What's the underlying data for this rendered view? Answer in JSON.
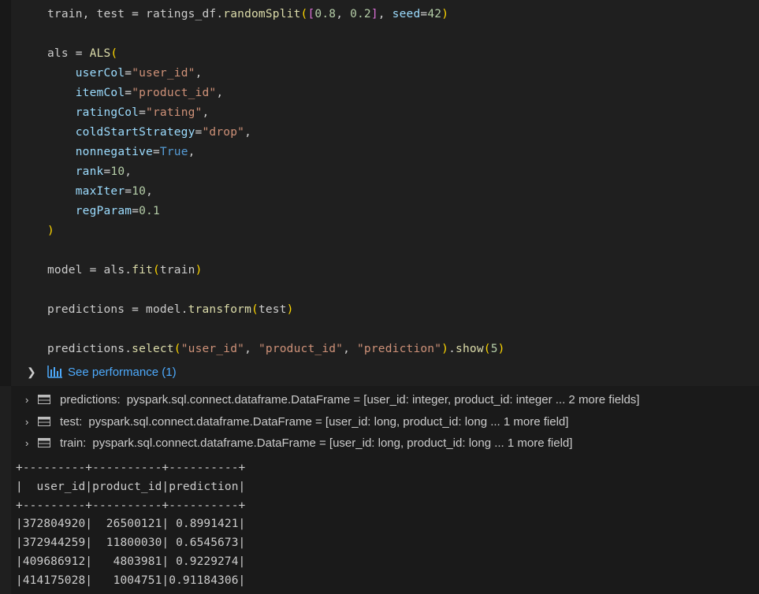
{
  "code": {
    "lines": [
      [
        {
          "t": "train, test ",
          "c": "ident"
        },
        {
          "t": "=",
          "c": "op"
        },
        {
          "t": " ratings_df.",
          "c": "ident"
        },
        {
          "t": "randomSplit",
          "c": "fn"
        },
        {
          "t": "(",
          "c": "br1"
        },
        {
          "t": "[",
          "c": "br2"
        },
        {
          "t": "0.8",
          "c": "num"
        },
        {
          "t": ", ",
          "c": "ident"
        },
        {
          "t": "0.2",
          "c": "num"
        },
        {
          "t": "]",
          "c": "br2"
        },
        {
          "t": ", ",
          "c": "ident"
        },
        {
          "t": "seed",
          "c": "param"
        },
        {
          "t": "=",
          "c": "op"
        },
        {
          "t": "42",
          "c": "num"
        },
        {
          "t": ")",
          "c": "br1"
        }
      ],
      [],
      [
        {
          "t": "als ",
          "c": "ident"
        },
        {
          "t": "=",
          "c": "op"
        },
        {
          "t": " ",
          "c": "ident"
        },
        {
          "t": "ALS",
          "c": "fn"
        },
        {
          "t": "(",
          "c": "br1"
        }
      ],
      [
        {
          "t": "    ",
          "c": "ident"
        },
        {
          "t": "userCol",
          "c": "param"
        },
        {
          "t": "=",
          "c": "op"
        },
        {
          "t": "\"user_id\"",
          "c": "str"
        },
        {
          "t": ",",
          "c": "ident"
        }
      ],
      [
        {
          "t": "    ",
          "c": "ident"
        },
        {
          "t": "itemCol",
          "c": "param"
        },
        {
          "t": "=",
          "c": "op"
        },
        {
          "t": "\"product_id\"",
          "c": "str"
        },
        {
          "t": ",",
          "c": "ident"
        }
      ],
      [
        {
          "t": "    ",
          "c": "ident"
        },
        {
          "t": "ratingCol",
          "c": "param"
        },
        {
          "t": "=",
          "c": "op"
        },
        {
          "t": "\"rating\"",
          "c": "str"
        },
        {
          "t": ",",
          "c": "ident"
        }
      ],
      [
        {
          "t": "    ",
          "c": "ident"
        },
        {
          "t": "coldStartStrategy",
          "c": "param"
        },
        {
          "t": "=",
          "c": "op"
        },
        {
          "t": "\"drop\"",
          "c": "str"
        },
        {
          "t": ",",
          "c": "ident"
        }
      ],
      [
        {
          "t": "    ",
          "c": "ident"
        },
        {
          "t": "nonnegative",
          "c": "param"
        },
        {
          "t": "=",
          "c": "op"
        },
        {
          "t": "True",
          "c": "kw"
        },
        {
          "t": ",",
          "c": "ident"
        }
      ],
      [
        {
          "t": "    ",
          "c": "ident"
        },
        {
          "t": "rank",
          "c": "param"
        },
        {
          "t": "=",
          "c": "op"
        },
        {
          "t": "10",
          "c": "num"
        },
        {
          "t": ",",
          "c": "ident"
        }
      ],
      [
        {
          "t": "    ",
          "c": "ident"
        },
        {
          "t": "maxIter",
          "c": "param"
        },
        {
          "t": "=",
          "c": "op"
        },
        {
          "t": "10",
          "c": "num"
        },
        {
          "t": ",",
          "c": "ident"
        }
      ],
      [
        {
          "t": "    ",
          "c": "ident"
        },
        {
          "t": "regParam",
          "c": "param"
        },
        {
          "t": "=",
          "c": "op"
        },
        {
          "t": "0.1",
          "c": "num"
        }
      ],
      [
        {
          "t": ")",
          "c": "br1"
        }
      ],
      [],
      [
        {
          "t": "model ",
          "c": "ident"
        },
        {
          "t": "=",
          "c": "op"
        },
        {
          "t": " als.",
          "c": "ident"
        },
        {
          "t": "fit",
          "c": "fn"
        },
        {
          "t": "(",
          "c": "br1"
        },
        {
          "t": "train",
          "c": "ident"
        },
        {
          "t": ")",
          "c": "br1"
        }
      ],
      [],
      [
        {
          "t": "predictions ",
          "c": "ident"
        },
        {
          "t": "=",
          "c": "op"
        },
        {
          "t": " model.",
          "c": "ident"
        },
        {
          "t": "transform",
          "c": "fn"
        },
        {
          "t": "(",
          "c": "br1"
        },
        {
          "t": "test",
          "c": "ident"
        },
        {
          "t": ")",
          "c": "br1"
        }
      ],
      [],
      [
        {
          "t": "predictions.",
          "c": "ident"
        },
        {
          "t": "select",
          "c": "fn"
        },
        {
          "t": "(",
          "c": "br1"
        },
        {
          "t": "\"user_id\"",
          "c": "str"
        },
        {
          "t": ", ",
          "c": "ident"
        },
        {
          "t": "\"product_id\"",
          "c": "str"
        },
        {
          "t": ", ",
          "c": "ident"
        },
        {
          "t": "\"prediction\"",
          "c": "str"
        },
        {
          "t": ")",
          "c": "br1"
        },
        {
          "t": ".",
          "c": "ident"
        },
        {
          "t": "show",
          "c": "fn"
        },
        {
          "t": "(",
          "c": "br1"
        },
        {
          "t": "5",
          "c": "num"
        },
        {
          "t": ")",
          "c": "br1"
        }
      ]
    ]
  },
  "performance": {
    "label": "See performance (1)",
    "icon": "bar-chart-icon"
  },
  "variables": [
    {
      "name": "predictions:",
      "value": "pyspark.sql.connect.dataframe.DataFrame = [user_id: integer, product_id: integer ... 2 more fields]"
    },
    {
      "name": "test:",
      "value": "pyspark.sql.connect.dataframe.DataFrame = [user_id: long, product_id: long ... 1 more field]"
    },
    {
      "name": "train:",
      "value": "pyspark.sql.connect.dataframe.DataFrame = [user_id: long, product_id: long ... 1 more field]"
    }
  ],
  "output_table": {
    "text": "+---------+----------+----------+\n|  user_id|product_id|prediction|\n+---------+----------+----------+\n|372804920|  26500121| 0.8991421|\n|372944259|  11800030| 0.6545673|\n|409686912|   4803981| 0.9229274|\n|414175028|   1004751|0.91184306|"
  },
  "colors": {
    "background": "#1f1f1f",
    "output_background": "#1a1a1a",
    "link": "#4daafc"
  }
}
